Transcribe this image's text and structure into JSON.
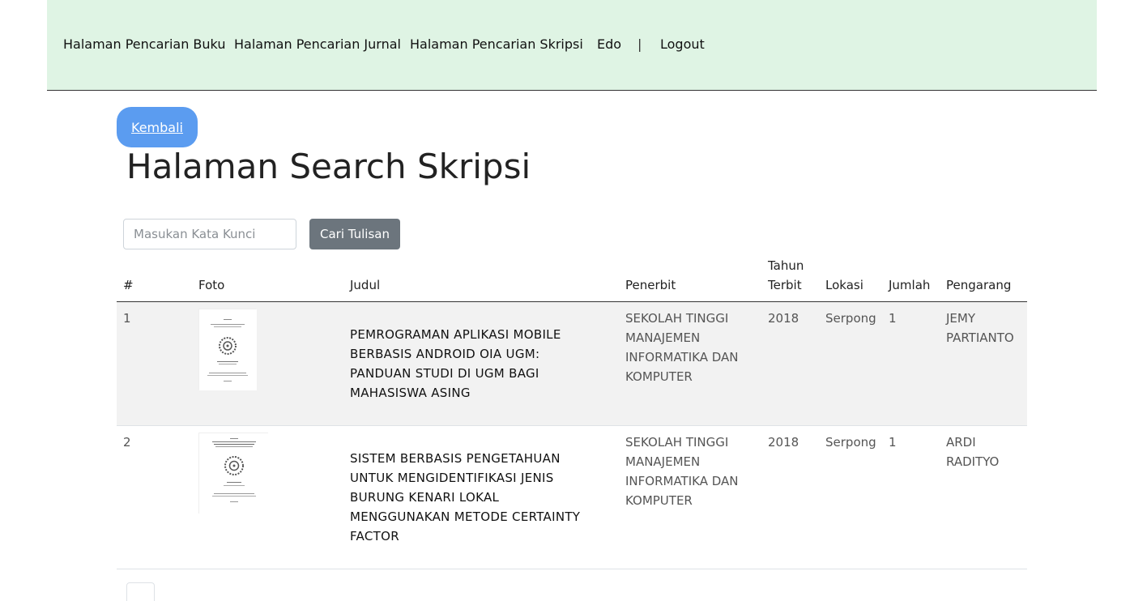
{
  "nav": {
    "book_search": "Halaman Pencarian Buku",
    "journal_search": "Halaman Pencarian Jurnal",
    "thesis_search": "Halaman Pencarian Skripsi",
    "user": "Edo",
    "separator": "|",
    "logout": "Logout"
  },
  "back_label": "Kembali",
  "page_title": "Halaman Search Skripsi",
  "search": {
    "placeholder": "Masukan Kata Kunci",
    "value": "",
    "button_label": "Cari Tulisan"
  },
  "table": {
    "headers": {
      "no": "#",
      "photo": "Foto",
      "title": "Judul",
      "publisher": "Penerbit",
      "year_line1": "Tahun",
      "year_line2": "Terbit",
      "location": "Lokasi",
      "count": "Jumlah",
      "author": "Pengarang"
    },
    "rows": [
      {
        "no": "1",
        "title": "PEMROGRAMAN APLIKASI MOBILE BERBASIS ANDROID OIA UGM: PANDUAN STUDI DI UGM BAGI MAHASISWA ASING",
        "publisher": "SEKOLAH TINGGI MANAJEMEN INFORMATIKA DAN KOMPUTER",
        "year": "2018",
        "location": "Serpong",
        "count": "1",
        "author": "JEMY PARTIANTO"
      },
      {
        "no": "2",
        "title": "SISTEM BERBASIS PENGETAHUAN UNTUK MENGIDENTIFIKASI JENIS BURUNG KENARI LOKAL MENGGUNAKAN METODE CERTAINTY FACTOR",
        "publisher": "SEKOLAH TINGGI MANAJEMEN INFORMATIKA DAN KOMPUTER",
        "year": "2018",
        "location": "Serpong",
        "count": "1",
        "author": "ARDI RADITYO"
      }
    ]
  }
}
